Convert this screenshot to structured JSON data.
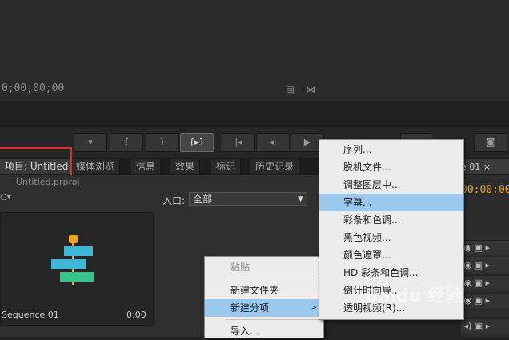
{
  "monitor": {
    "timecode": "0;00;00;00",
    "icons": [
      "film-icon",
      "waveform-icon"
    ]
  },
  "transport": {
    "buttons": [
      "marker-icon",
      "in-point-icon",
      "out-point-icon",
      "go-to-in-out-icon",
      "step-back-icon",
      "play-back-icon",
      "play-icon",
      "step-forward-icon",
      "camera-icon"
    ]
  },
  "tabs": [
    {
      "label": "项目: Untitled ×"
    },
    {
      "label": "媒体浏览"
    },
    {
      "label": "信息"
    },
    {
      "label": "效果"
    },
    {
      "label": "标记"
    },
    {
      "label": "历史记录"
    }
  ],
  "project": {
    "file": "Untitled.prproj",
    "entry_label": "入口:",
    "entry_value": "全部",
    "sequence_name": "Sequence 01",
    "sequence_duration": "0:00"
  },
  "sequence_panel": {
    "tab": "ce 01 ×",
    "timecode": "00:00:00"
  },
  "context_menu": {
    "items": [
      {
        "label": "粘贴",
        "disabled": true
      },
      {
        "label": "新建文件夹"
      },
      {
        "label": "新建分项",
        "selected": true,
        "submenu": true
      },
      {
        "label": "导入..."
      }
    ]
  },
  "submenu": {
    "items": [
      {
        "label": "序列..."
      },
      {
        "label": "脱机文件..."
      },
      {
        "label": "调整图层中..."
      },
      {
        "label": "字幕...",
        "selected": true
      },
      {
        "label": "彩条和色调..."
      },
      {
        "label": "黑色视频..."
      },
      {
        "label": "颜色遮罩..."
      },
      {
        "label": "HD 彩条和色调..."
      },
      {
        "label": "倒计时向导..."
      },
      {
        "label": "透明视频(R)..."
      }
    ]
  },
  "watermark": "Baidu 经验",
  "colors": {
    "accent": "#e8a62f",
    "menu_selected": "#99c9ef",
    "highlight_box": "#d9302c"
  }
}
